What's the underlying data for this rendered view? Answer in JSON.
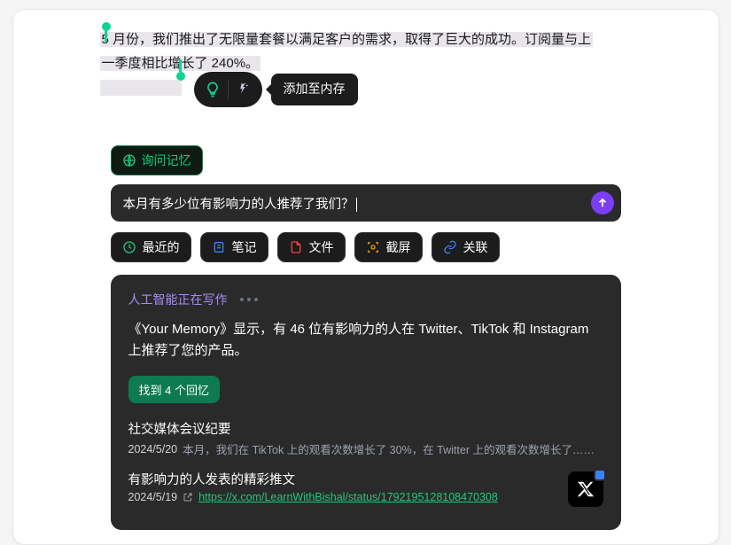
{
  "highlight": {
    "line1": "5 月份，我们推出了无限量套餐以满足客户的需求，取得了巨大的成功。订阅量与上",
    "line2": "一季度相比增长了 240%。"
  },
  "popover": {
    "tooltip": "添加至内存"
  },
  "ask_chip": "询问记忆",
  "input": {
    "value": "本月有多少位有影响力的人推荐了我们？"
  },
  "filters": {
    "recent": "最近的",
    "notes": "笔记",
    "files": "文件",
    "screenshot": "截屏",
    "related": "关联"
  },
  "ai": {
    "status": "人工智能正在写作",
    "body": "《Your Memory》显示，有 46 位有影响力的人在 Twitter、TikTok 和 Instagram 上推荐了您的产品。",
    "found": "找到 4 个回忆",
    "memories": [
      {
        "title": "社交媒体会议纪要",
        "date": "2024/5/20",
        "desc": "本月，我们在 TikTok 上的观看次数增长了 30%，在 Twitter 上的观看次数增长了……"
      },
      {
        "title": "有影响力的人发表的精彩推文",
        "date": "2024/5/19",
        "url": "https://x.com/LearnWithBishal/status/1792195128108470308"
      }
    ]
  }
}
